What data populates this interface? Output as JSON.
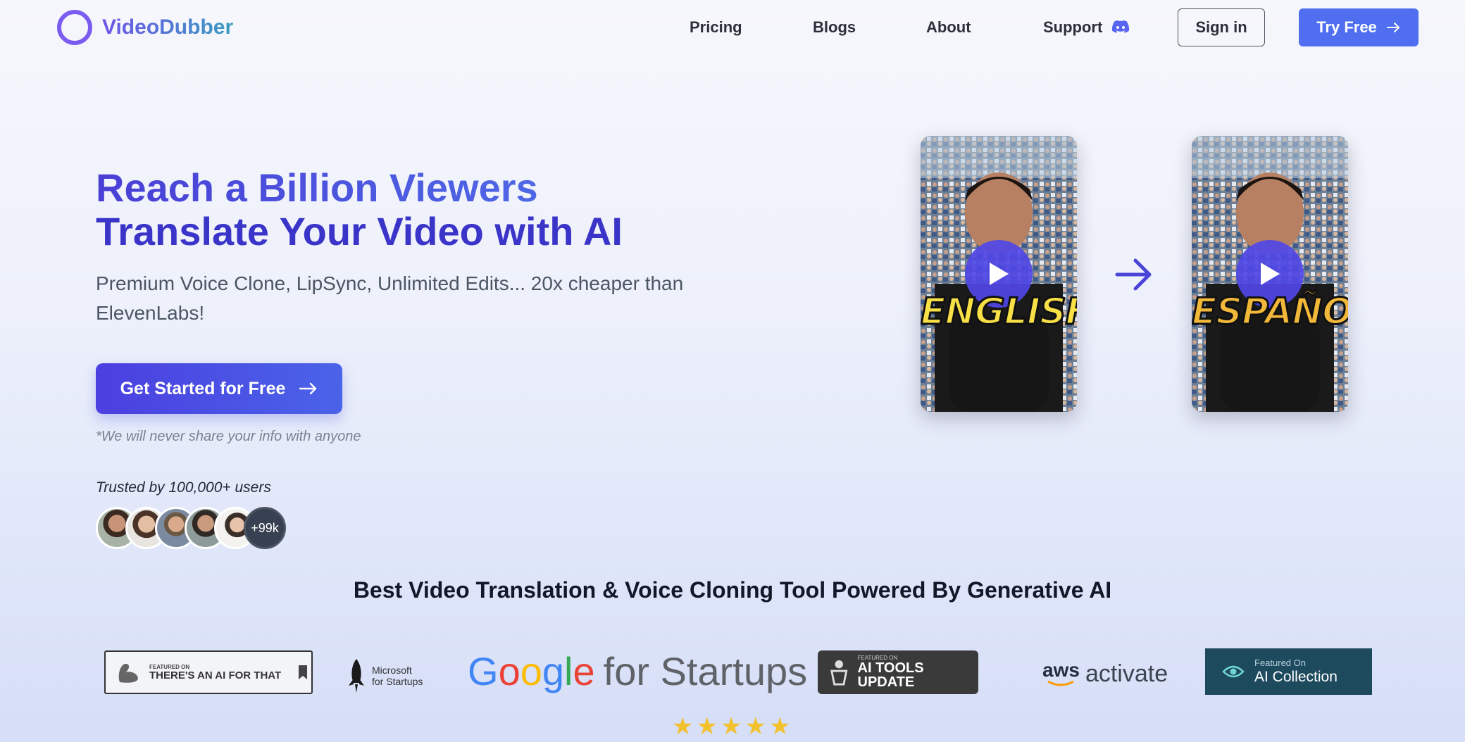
{
  "header": {
    "brand": "VideoDubber",
    "nav": [
      {
        "label": "Pricing"
      },
      {
        "label": "Blogs"
      },
      {
        "label": "About"
      },
      {
        "label": "Support"
      }
    ],
    "signin_label": "Sign in",
    "tryfree_label": "Try Free"
  },
  "hero": {
    "title_line1": "Reach a Billion Viewers",
    "title_line2": "Translate Your Video with AI",
    "subtitle": "Premium Voice Clone, LipSync, Unlimited Edits... 20x cheaper than ElevenLabs!",
    "cta_label": "Get Started for Free",
    "disclaimer": "*We will never share your info with anyone",
    "trusted_text": "Trusted by 100,000+ users",
    "more_users": "+99k"
  },
  "videos": [
    {
      "caption": "ENGLISH"
    },
    {
      "caption": "ESPAÑOL"
    }
  ],
  "tagline": "Best Video Translation & Voice Cloning Tool Powered By Generative AI",
  "featured": {
    "aift_small": "FEATURED ON",
    "aift_name": "THERE'S AN AI FOR THAT",
    "ms_line1": "Microsoft",
    "ms_line2": "for Startups",
    "google_suffix": "for Startups",
    "atu_small": "FEATURED ON",
    "atu_name": "AI TOOLS UPDATE",
    "aws_word": "aws",
    "aws_activate": "activate",
    "aic_small": "Featured On",
    "aic_name": "AI Collection"
  },
  "rating": {
    "stars": 5
  },
  "colors": {
    "accent": "#4f6ff0",
    "brand_purple": "#7b5cf0",
    "title_blue": "#3b34c8",
    "star": "#f2c12e"
  }
}
